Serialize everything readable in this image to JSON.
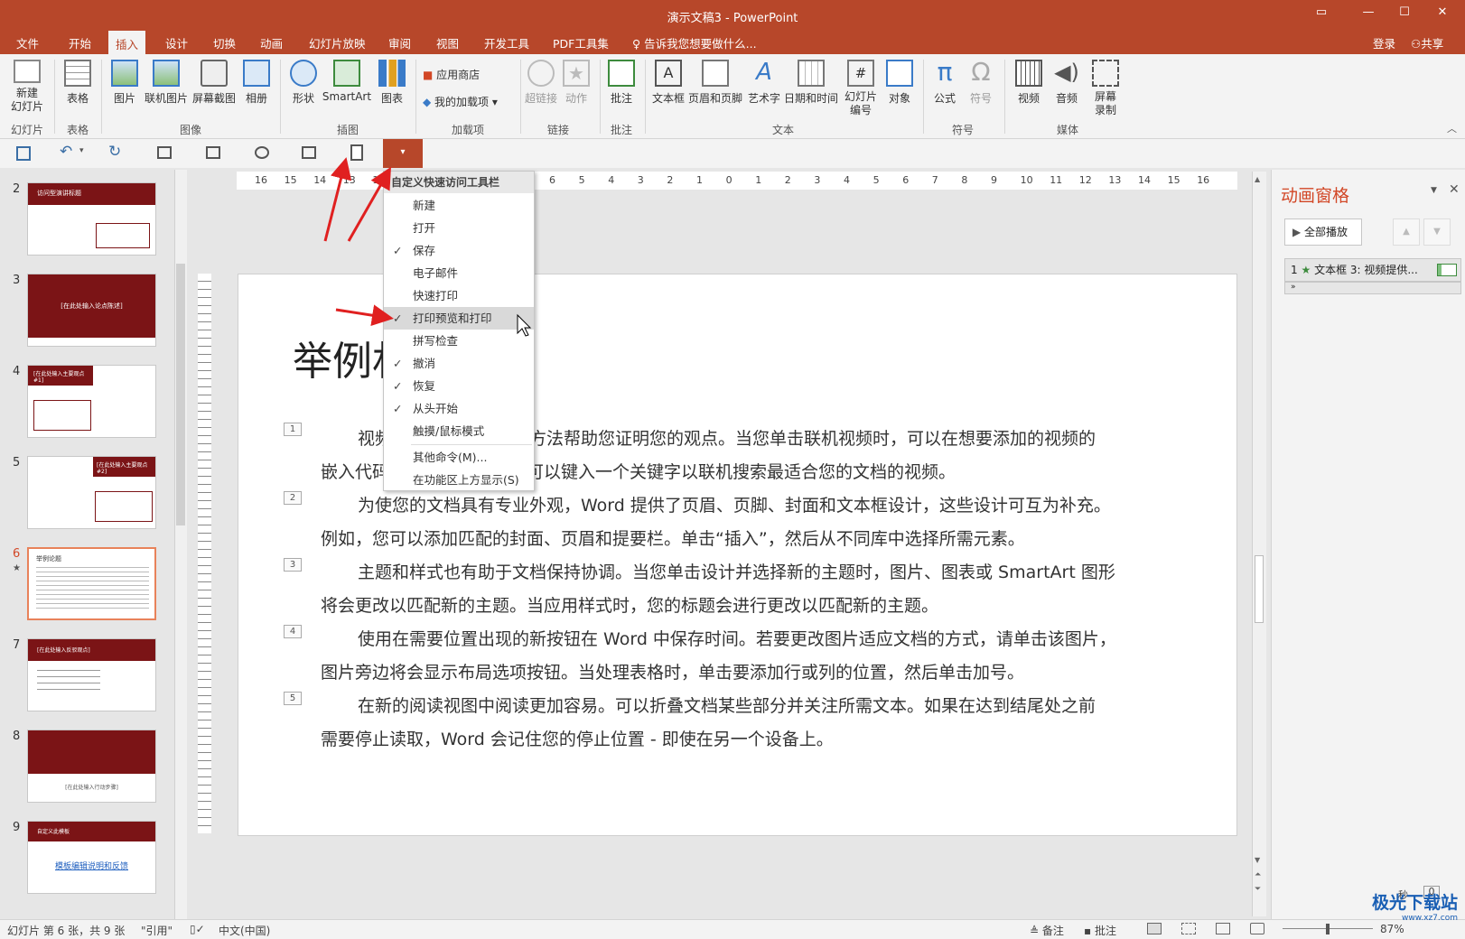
{
  "window": {
    "title": "演示文稿3 - PowerPoint",
    "login": "登录",
    "share": "共享"
  },
  "menu_tabs": [
    "文件",
    "开始",
    "插入",
    "设计",
    "切换",
    "动画",
    "幻灯片放映",
    "审阅",
    "视图",
    "开发工具",
    "PDF工具集"
  ],
  "tell_me": "告诉我您想要做什么...",
  "ribbon": {
    "new_slide": "新建\n幻灯片",
    "table": "表格",
    "picture": "图片",
    "online_picture": "联机图片",
    "screenshot": "屏幕截图",
    "album": "相册",
    "shapes": "形状",
    "smartart": "SmartArt",
    "chart": "图表",
    "store": "应用商店",
    "my_addins": "我的加载项",
    "hyperlink": "超链接",
    "action": "动作",
    "comment": "批注",
    "textbox": "文本框",
    "header_footer": "页眉和页脚",
    "wordart": "艺术字",
    "datetime": "日期和时间",
    "slide_number": "幻灯片\n编号",
    "object": "对象",
    "equation": "公式",
    "symbol": "符号",
    "video": "视频",
    "audio": "音频",
    "screen_rec": "屏幕\n录制",
    "groups": {
      "slides": "幻灯片",
      "tables": "表格",
      "images": "图像",
      "illustrations": "插图",
      "addins": "加载项",
      "links": "链接",
      "comments": "批注",
      "text": "文本",
      "symbols": "符号",
      "media": "媒体"
    }
  },
  "dropdown": {
    "header": "自定义快速访问工具栏",
    "items": [
      {
        "label": "新建",
        "checked": false
      },
      {
        "label": "打开",
        "checked": false
      },
      {
        "label": "保存",
        "checked": true
      },
      {
        "label": "电子邮件",
        "checked": false
      },
      {
        "label": "快速打印",
        "checked": false
      },
      {
        "label": "打印预览和打印",
        "checked": true
      },
      {
        "label": "拼写检查",
        "checked": false
      },
      {
        "label": "撤消",
        "checked": true
      },
      {
        "label": "恢复",
        "checked": true
      },
      {
        "label": "从头开始",
        "checked": true
      },
      {
        "label": "触摸/鼠标模式",
        "checked": false
      },
      {
        "label": "其他命令(M)...",
        "checked": false
      },
      {
        "label": "在功能区上方显示(S)",
        "checked": false
      }
    ]
  },
  "thumbs": [
    {
      "num": "2",
      "title": "访问型演讲标题"
    },
    {
      "num": "3",
      "title": "[在此处输入论点陈述]"
    },
    {
      "num": "4",
      "title": "[在此处输入主要观点 #1]"
    },
    {
      "num": "5",
      "title": "[在此处输入主要观点 #2]"
    },
    {
      "num": "6",
      "title": "举例论题",
      "star": "★"
    },
    {
      "num": "7",
      "title": "[在此处输入反驳观点]"
    },
    {
      "num": "8",
      "title": "[在此处输入行动步骤]"
    },
    {
      "num": "9",
      "title": "自定义此模板",
      "link": "模板编辑说明和反馈"
    }
  ],
  "slide": {
    "title": "举例林",
    "paragraphs": [
      {
        "n": "1",
        "l1": "视频提供了功能强大的方法帮助您证明您的观点。当您单击联机视频时，可以在想要添加的视频的",
        "l2": "嵌入代码中进行粘贴。您也可以键入一个关键字以联机搜索最适合您的文档的视频。"
      },
      {
        "n": "2",
        "l1": "为使您的文档具有专业外观，Word 提供了页眉、页脚、封面和文本框设计，这些设计可互为补充。",
        "l2": "例如，您可以添加匹配的封面、页眉和提要栏。单击“插入”，然后从不同库中选择所需元素。"
      },
      {
        "n": "3",
        "l1": "主题和样式也有助于文档保持协调。当您单击设计并选择新的主题时，图片、图表或 SmartArt 图形",
        "l2": "将会更改以匹配新的主题。当应用样式时，您的标题会进行更改以匹配新的主题。"
      },
      {
        "n": "4",
        "l1": "使用在需要位置出现的新按钮在 Word 中保存时间。若要更改图片适应文档的方式，请单击该图片，",
        "l2": "图片旁边将会显示布局选项按钮。当处理表格时，单击要添加行或列的位置，然后单击加号。"
      },
      {
        "n": "5",
        "l1": "在新的阅读视图中阅读更加容易。可以折叠文档某些部分并关注所需文本。如果在达到结尾处之前",
        "l2": "需要停止读取，Word 会记住您的停止位置 - 即使在另一个设备上。"
      }
    ]
  },
  "anim_pane": {
    "title": "动画窗格",
    "play_all": "全部播放",
    "item_num": "1",
    "item_label": "文本框 3: 视频提供...",
    "seconds": "秒"
  },
  "ruler_labels": [
    "16",
    "15",
    "14",
    "13",
    "12",
    "11",
    "10",
    "9",
    "8",
    "7",
    "6",
    "5",
    "4",
    "3",
    "2",
    "1",
    "0",
    "1",
    "2",
    "3",
    "4",
    "5",
    "6",
    "7",
    "8",
    "9",
    "10",
    "11",
    "12",
    "13",
    "14",
    "15",
    "16"
  ],
  "status": {
    "slide_info": "幻灯片 第 6 张，共 9 张",
    "quote": "\"引用\"",
    "lang": "中文(中国)",
    "notes": "备注",
    "comments": "批注",
    "zoom": "87%"
  },
  "watermark": {
    "name": "极光下载站",
    "url": "www.xz7.com"
  },
  "colors": {
    "accent": "#b7472a",
    "dark_red": "#7b1416",
    "arrow": "#e02020"
  }
}
